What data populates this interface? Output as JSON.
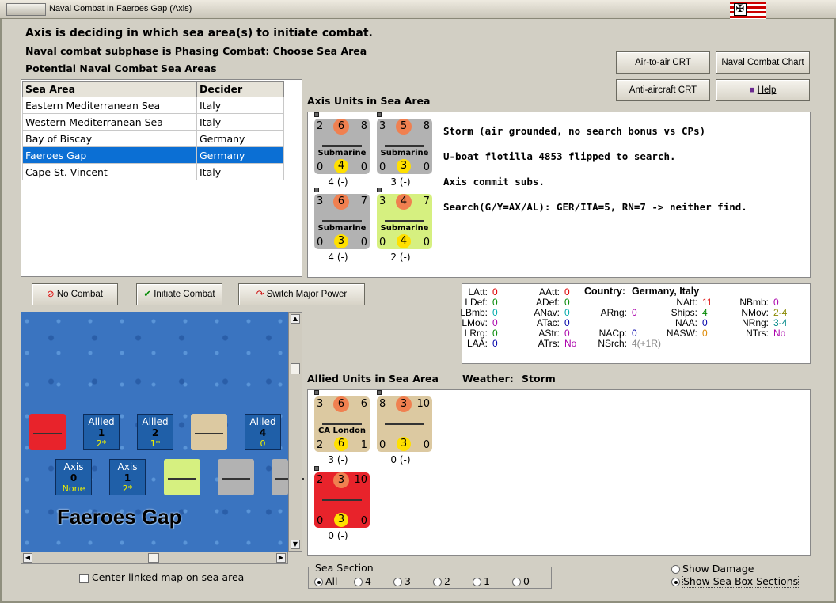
{
  "window": {
    "title": "Naval Combat In Faeroes Gap (Axis)"
  },
  "header": {
    "line1": "Axis is deciding in which sea area(s) to initiate combat.",
    "line2": "Naval combat subphase is Phasing Combat: Choose Sea Area",
    "line3": "Potential Naval Combat Sea Areas"
  },
  "buttons": {
    "air_crt": "Air-to-air CRT",
    "naval_chart": "Naval Combat Chart",
    "aa_crt": "Anti-aircraft CRT",
    "help": "Help",
    "no_combat": "No Combat",
    "initiate": "Initiate Combat",
    "switch": "Switch Major Power"
  },
  "sea_table": {
    "headers": [
      "Sea Area",
      "Decider"
    ],
    "rows": [
      [
        "Eastern Mediterranean Sea",
        "Italy"
      ],
      [
        "Western Mediterranean Sea",
        "Italy"
      ],
      [
        "Bay of Biscay",
        "Germany"
      ],
      [
        "Faeroes Gap",
        "Germany"
      ],
      [
        "Cape St. Vincent",
        "Italy"
      ]
    ],
    "selected": 3
  },
  "axis": {
    "label": "Axis Units in Sea Area",
    "units": [
      {
        "tl": "2",
        "tc": "6",
        "tr": "8",
        "name": "Submarine",
        "bl": "0",
        "bc": "4",
        "br": "0",
        "count": "4 (-)",
        "color": "gray"
      },
      {
        "tl": "3",
        "tc": "5",
        "tr": "8",
        "name": "Submarine",
        "bl": "0",
        "bc": "3",
        "br": "0",
        "count": "3 (-)",
        "color": "gray"
      },
      {
        "tl": "3",
        "tc": "6",
        "tr": "7",
        "name": "Submarine",
        "bl": "0",
        "bc": "3",
        "br": "0",
        "count": "4 (-)",
        "color": "gray"
      },
      {
        "tl": "3",
        "tc": "4",
        "tr": "7",
        "name": "Submarine",
        "bl": "0",
        "bc": "4",
        "br": "0",
        "count": "2 (-)",
        "color": "lime"
      }
    ],
    "messages": [
      "Storm (air grounded, no search bonus vs CPs)",
      " U-boat flotilla 4853 flipped to search.",
      "Axis commit subs.",
      "Search(G/Y=AX/AL):  GER/ITA=5, RN=7 -> neither find."
    ]
  },
  "stats": {
    "LAtt": "0",
    "LDef": "0",
    "LBmb": "0",
    "LMov": "0",
    "LRrg": "0",
    "LAA": "0",
    "AAtt": "0",
    "ADef": "0",
    "ANav": "0",
    "ATac": "0",
    "AStr": "0",
    "ATrs": "No",
    "ARng": "0",
    "NACp": "0",
    "NSrch": "4(+1R)",
    "country_label": "Country:",
    "country": "Germany, Italy",
    "NAtt": "11",
    "Ships": "4",
    "NAA": "0",
    "NASW": "0",
    "NBmb": "0",
    "NMov": "2-4",
    "NRng": "3-4",
    "NTrs": "No"
  },
  "allied": {
    "label": "Allied Units in Sea Area",
    "weather_label": "Weather:",
    "weather": "Storm",
    "units": [
      {
        "tl": "3",
        "tc": "6",
        "tr": "6",
        "name": "CA London",
        "bl": "2",
        "bc": "6",
        "br": "1",
        "count": "3 (-)",
        "color": "tan"
      },
      {
        "tl": "8",
        "tc": "3",
        "tr": "10",
        "name": "",
        "bl": "0",
        "bc": "3",
        "br": "0",
        "count": "0 (-)",
        "color": "tan"
      },
      {
        "tl": "2",
        "tc": "3",
        "tr": "10",
        "name": "",
        "bl": "0",
        "bc": "3",
        "br": "0",
        "count": "0 (-)",
        "color": "red"
      }
    ]
  },
  "map": {
    "name": "Faeroes Gap",
    "boxes": [
      {
        "side": "Allied",
        "num": "1",
        "sub": "2*"
      },
      {
        "side": "Allied",
        "num": "2",
        "sub": "1*"
      },
      {
        "side": "Allied",
        "num": "4",
        "sub": "0"
      },
      {
        "side": "Axis",
        "num": "0",
        "sub": "None"
      },
      {
        "side": "Axis",
        "num": "1",
        "sub": "2*"
      }
    ],
    "center_linked": "Center linked map on sea area"
  },
  "sea_section": {
    "label": "Sea Section",
    "options": [
      "All",
      "4",
      "3",
      "2",
      "1",
      "0"
    ],
    "selected": 0
  },
  "options": {
    "show_damage": "Show Damage",
    "show_sections": "Show Sea Box Sections"
  },
  "colors": {
    "selection": "#0b6fd4",
    "sea": "#3a74c0"
  }
}
